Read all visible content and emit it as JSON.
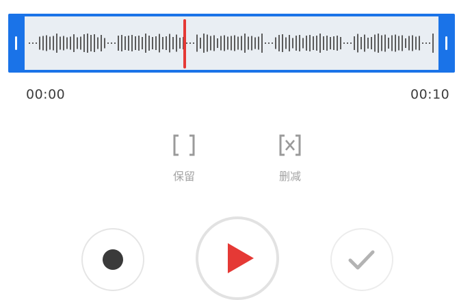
{
  "editor": {
    "start_time": "00:00",
    "end_time": "00:10",
    "playhead_fraction": 0.42
  },
  "actions": {
    "keep_label": "保留",
    "delete_label": "删减"
  },
  "controls": {
    "record_icon": "record-icon",
    "play_icon": "play-icon",
    "confirm_icon": "check-icon"
  },
  "colors": {
    "accent": "#1a73e8",
    "playhead": "#e53935",
    "play": "#e53935",
    "wave": "#5a5a5a",
    "wave_bg": "#e9eef3"
  }
}
